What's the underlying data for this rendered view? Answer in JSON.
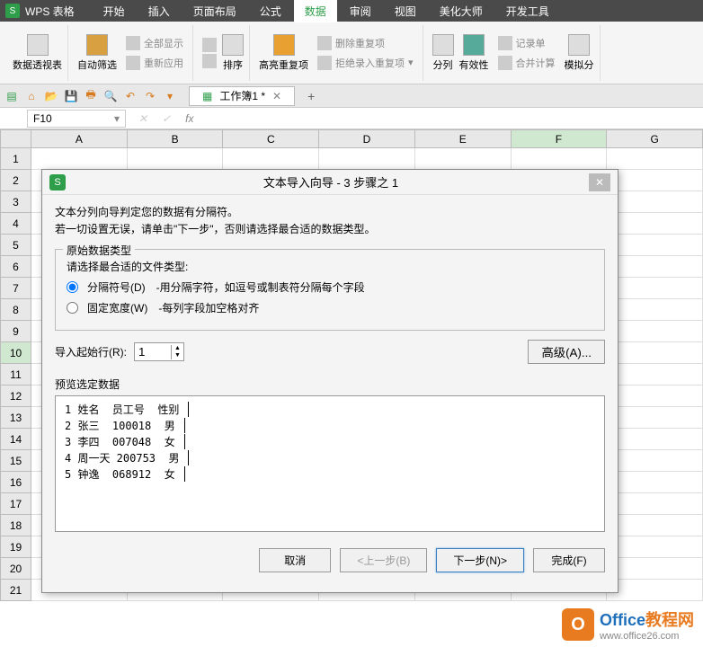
{
  "app": {
    "name": "WPS 表格",
    "logo_text": "S"
  },
  "menu": [
    "开始",
    "插入",
    "页面布局",
    "公式",
    "数据",
    "审阅",
    "视图",
    "美化大师",
    "开发工具"
  ],
  "menu_active": 4,
  "ribbon": {
    "pivot": "数据透视表",
    "autofilter": "自动筛选",
    "showall": "全部显示",
    "reapply": "重新应用",
    "sort": "排序",
    "highlight": "高亮重复项",
    "removedup": "删除重复项",
    "rejectdup": "拒绝录入重复项",
    "col_split": "分列",
    "validity": "有效性",
    "record": "记录单",
    "consolidate": "合并计算",
    "whatif": "模拟分"
  },
  "quick_access": {
    "doc_tab": "工作簿1 *"
  },
  "namebox": "F10",
  "columns": [
    "A",
    "B",
    "C",
    "D",
    "E",
    "F",
    "G"
  ],
  "rows_active": 10,
  "col_active": 5,
  "row_count": 21,
  "dialog": {
    "title": "文本导入向导 - 3 步骤之 1",
    "instr1": "文本分列向导判定您的数据有分隔符。",
    "instr2": "若一切设置无误，请单击\"下一步\"，否则请选择最合适的数据类型。",
    "fieldset_label": "原始数据类型",
    "choose_label": "请选择最合适的文件类型:",
    "radio_delim": "分隔符号(D)",
    "radio_delim_desc": "-用分隔字符，如逗号或制表符分隔每个字段",
    "radio_fixed": "固定宽度(W)",
    "radio_fixed_desc": "-每列字段加空格对齐",
    "startrow_label": "导入起始行(R):",
    "startrow_value": "1",
    "advanced": "高级(A)...",
    "preview_label": "预览选定数据",
    "preview_lines": [
      "1 姓名  员工号  性别",
      "2 张三  100018  男",
      "3 李四  007048  女",
      "4 周一天 200753  男",
      "5 钟逸  068912  女"
    ],
    "btn_cancel": "取消",
    "btn_back": "<上一步(B)",
    "btn_next": "下一步(N)>",
    "btn_finish": "完成(F)"
  },
  "watermark": {
    "line1a": "Office",
    "line1b": "教程网",
    "line2": "www.office26.com"
  }
}
